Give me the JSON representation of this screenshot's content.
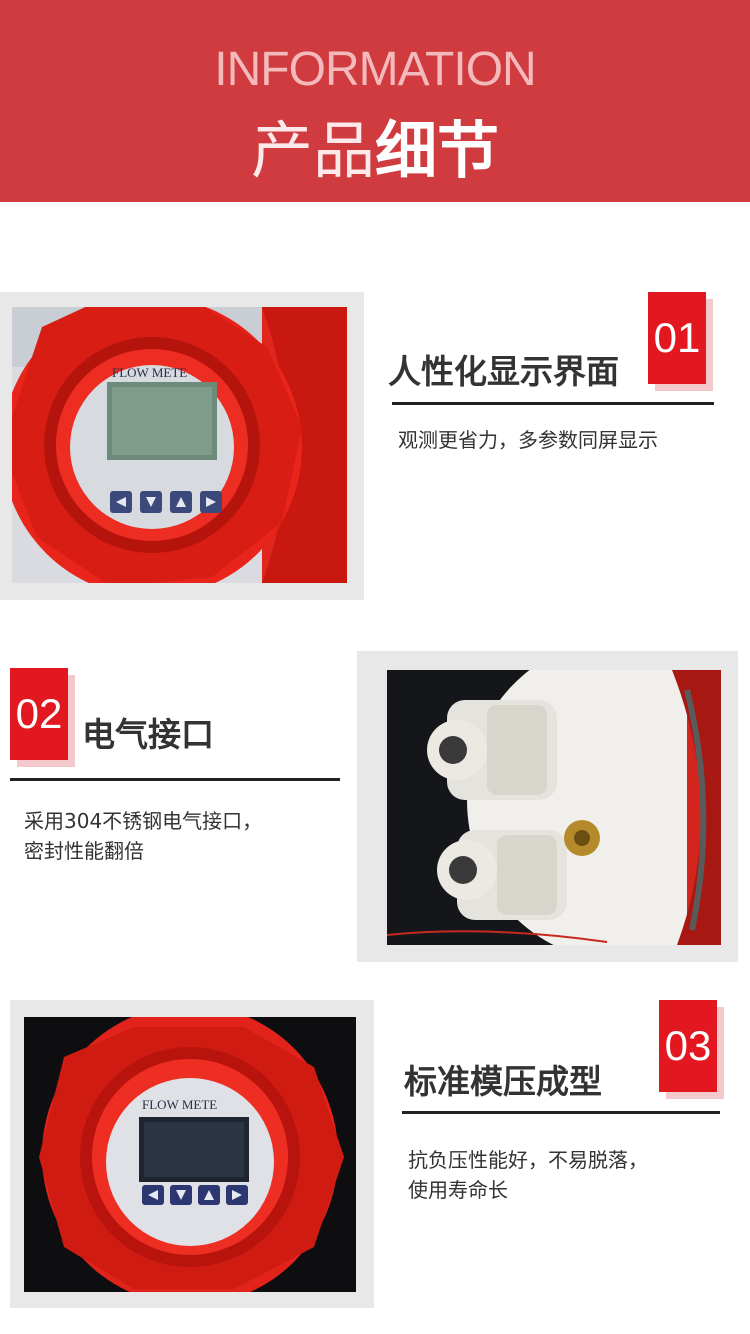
{
  "header": {
    "en_title": "INFORMATION",
    "cn_title_light": "产品",
    "cn_title_bold": "细节"
  },
  "sections": [
    {
      "number": "01",
      "title": "人性化显示界面",
      "desc_lines": [
        "观测更省力，多参数同屏显示"
      ],
      "photo_label": "FLOW METE"
    },
    {
      "number": "02",
      "title": "电气接口",
      "desc_lines": [
        "采用304不锈钢电气接口，",
        "密封性能翻倍"
      ]
    },
    {
      "number": "03",
      "title": "标准模压成型",
      "desc_lines": [
        "抗负压性能好，不易脱落，",
        "使用寿命长"
      ],
      "photo_label": "FLOW METE"
    }
  ],
  "colors": {
    "banner": "#cf3b3f",
    "accent": "#e3171f",
    "frame": "#e8e8e8"
  }
}
